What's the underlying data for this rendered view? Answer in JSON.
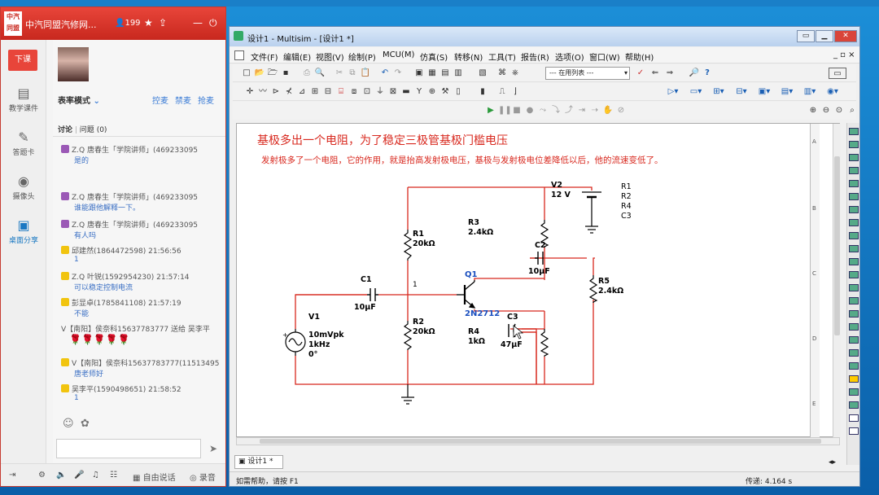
{
  "chat": {
    "title": "中汽同盟汽修网...",
    "logo_text": "中汽同盟",
    "viewer_count": "199",
    "side": {
      "end_class": "下课",
      "courseware": "教学课件",
      "answer_card": "答题卡",
      "camera": "摄像头",
      "desktop_share": "桌面分享"
    },
    "mode": "表率模式",
    "actions": [
      "控麦",
      "禁麦",
      "抢麦"
    ],
    "discussion_tab": "讨论",
    "question_tab": "问题",
    "question_count": "(0)",
    "messages": [
      {
        "sender": "Z.Q 唐春生「学院讲师」(469233095",
        "text": "是的"
      },
      {
        "sender": "Z.Q 唐春生「学院讲师」(469233095",
        "text": "谁能跟他解释一下。"
      },
      {
        "sender": "Z.Q 唐春生「学院讲师」(469233095",
        "text": "有人吗"
      },
      {
        "sender": "邱建然(1864472598) 21:56:56",
        "text": "1"
      },
      {
        "sender": "Z.Q 叶锐(1592954230) 21:57:14",
        "text": "可以稳定控制电流"
      },
      {
        "sender": "彭显卓(1785841108) 21:57:19",
        "text": "不能"
      },
      {
        "sender": "V【南阳】侯奈科15637783777 送给 吴李平",
        "text": ""
      },
      {
        "sender": "V【南阳】侯奈科15637783777(11513495",
        "text": "唐老师好"
      },
      {
        "sender": "吴李平(1590498651) 21:58:52",
        "text": "1"
      }
    ],
    "bottom": {
      "free_talk": "自由说话",
      "record": "录音"
    }
  },
  "multisim": {
    "title": "设计1 - Multisim - [设计1 *]",
    "menu": [
      "文件(F)",
      "编辑(E)",
      "视图(V)",
      "绘制(P)",
      "MCU(M)",
      "仿真(S)",
      "转移(N)",
      "工具(T)",
      "报告(R)",
      "选项(O)",
      "窗口(W)",
      "帮助(H)"
    ],
    "in_use_list": "--- 在用列表 ---",
    "tab": "设计1 *",
    "status_help": "如需帮助，请按 F1",
    "status_time": "传递: 4.164 s",
    "ruler_labels": [
      "A",
      "B",
      "C",
      "D",
      "E"
    ]
  },
  "schematic": {
    "heading": "基极多出一个电阻，为了稳定三极管基极门槛电压",
    "note": "发射极多了一个电阻，它的作用，就是抬高发射极电压，基极与发射极电位差降低以后，他的流速变低了。",
    "parts_list": [
      "R1",
      "R2",
      "R4",
      "C3"
    ],
    "components": {
      "V2": {
        "name": "V2",
        "value": "12 V"
      },
      "R1": {
        "name": "R1",
        "value": "20kΩ"
      },
      "R2": {
        "name": "R2",
        "value": "20kΩ"
      },
      "R3": {
        "name": "R3",
        "value": "2.4kΩ"
      },
      "R4": {
        "name": "R4",
        "value": "1kΩ"
      },
      "R5": {
        "name": "R5",
        "value": "2.4kΩ"
      },
      "C1": {
        "name": "C1",
        "value": "10µF"
      },
      "C2": {
        "name": "C2",
        "value": "10µF"
      },
      "C3": {
        "name": "C3",
        "value": "47µF"
      },
      "Q1": {
        "name": "Q1",
        "value": "2N2712"
      },
      "V1": {
        "name": "V1",
        "amp": "10mVpk",
        "freq": "1kHz",
        "phase": "0°"
      },
      "node": "1"
    }
  }
}
